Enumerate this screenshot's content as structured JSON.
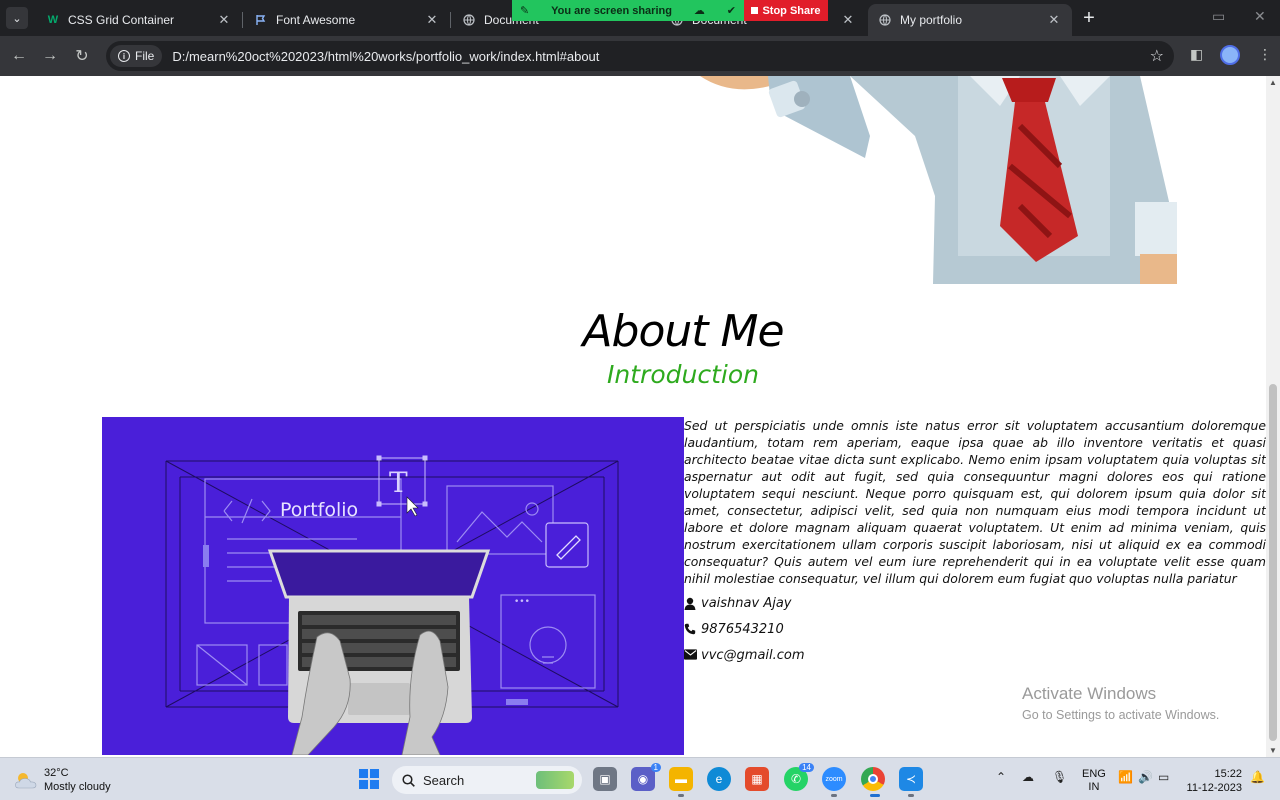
{
  "browser": {
    "tabs": [
      {
        "title": "CSS Grid Container",
        "favicon": "w3schools-icon",
        "active": false
      },
      {
        "title": "Font Awesome",
        "favicon": "flag-icon",
        "active": false
      },
      {
        "title": "Document",
        "favicon": "globe-icon",
        "active": false
      },
      {
        "title": "Document",
        "favicon": "globe-icon",
        "active": false
      },
      {
        "title": "My portfolio",
        "favicon": "globe-icon",
        "active": true
      }
    ],
    "screen_share": {
      "message": "You are screen sharing",
      "stop_label": "Stop Share"
    },
    "address": {
      "chip_label": "File",
      "url": "D:/mearn%20oct%202023/html%20works/portfolio_work/index.html#about"
    }
  },
  "page": {
    "about_title": "About Me",
    "about_subtitle": "Introduction",
    "illustration_label": "Portfolio",
    "illustration_letter": "T",
    "about_paragraph": "Sed ut perspiciatis unde omnis iste natus error sit voluptatem accusantium doloremque laudantium, totam rem aperiam, eaque ipsa quae ab illo inventore veritatis et quasi architecto beatae vitae dicta sunt explicabo. Nemo enim ipsam voluptatem quia voluptas sit aspernatur aut odit aut fugit, sed quia consequuntur magni dolores eos qui ratione voluptatem sequi nesciunt. Neque porro quisquam est, qui dolorem ipsum quia dolor sit amet, consectetur, adipisci velit, sed quia non numquam eius modi tempora incidunt ut labore et dolore magnam aliquam quaerat voluptatem. Ut enim ad minima veniam, quis nostrum exercitationem ullam corporis suscipit laboriosam, nisi ut aliquid ex ea commodi consequatur? Quis autem vel eum iure reprehenderit qui in ea voluptate velit esse quam nihil molestiae consequatur, vel illum qui dolorem eum fugiat quo voluptas nulla pariatur",
    "contact": {
      "name": "vaishnav Ajay",
      "phone": "9876543210",
      "email": "vvc@gmail.com"
    },
    "watermark": {
      "line1": "Activate Windows",
      "line2": "Go to Settings to activate Windows."
    }
  },
  "taskbar": {
    "weather": {
      "temp": "32°C",
      "condition": "Mostly cloudy"
    },
    "search_label": "Search",
    "teams_badge": "1",
    "whatsapp_badge": "14",
    "lang": {
      "line1": "ENG",
      "line2": "IN"
    },
    "time": "15:22",
    "date": "11-12-2023"
  },
  "colors": {
    "accent_green": "#2eaa1e",
    "illustration_bg": "#4a1fd9",
    "share_green": "#22c55e",
    "share_red": "#e11d2a"
  }
}
